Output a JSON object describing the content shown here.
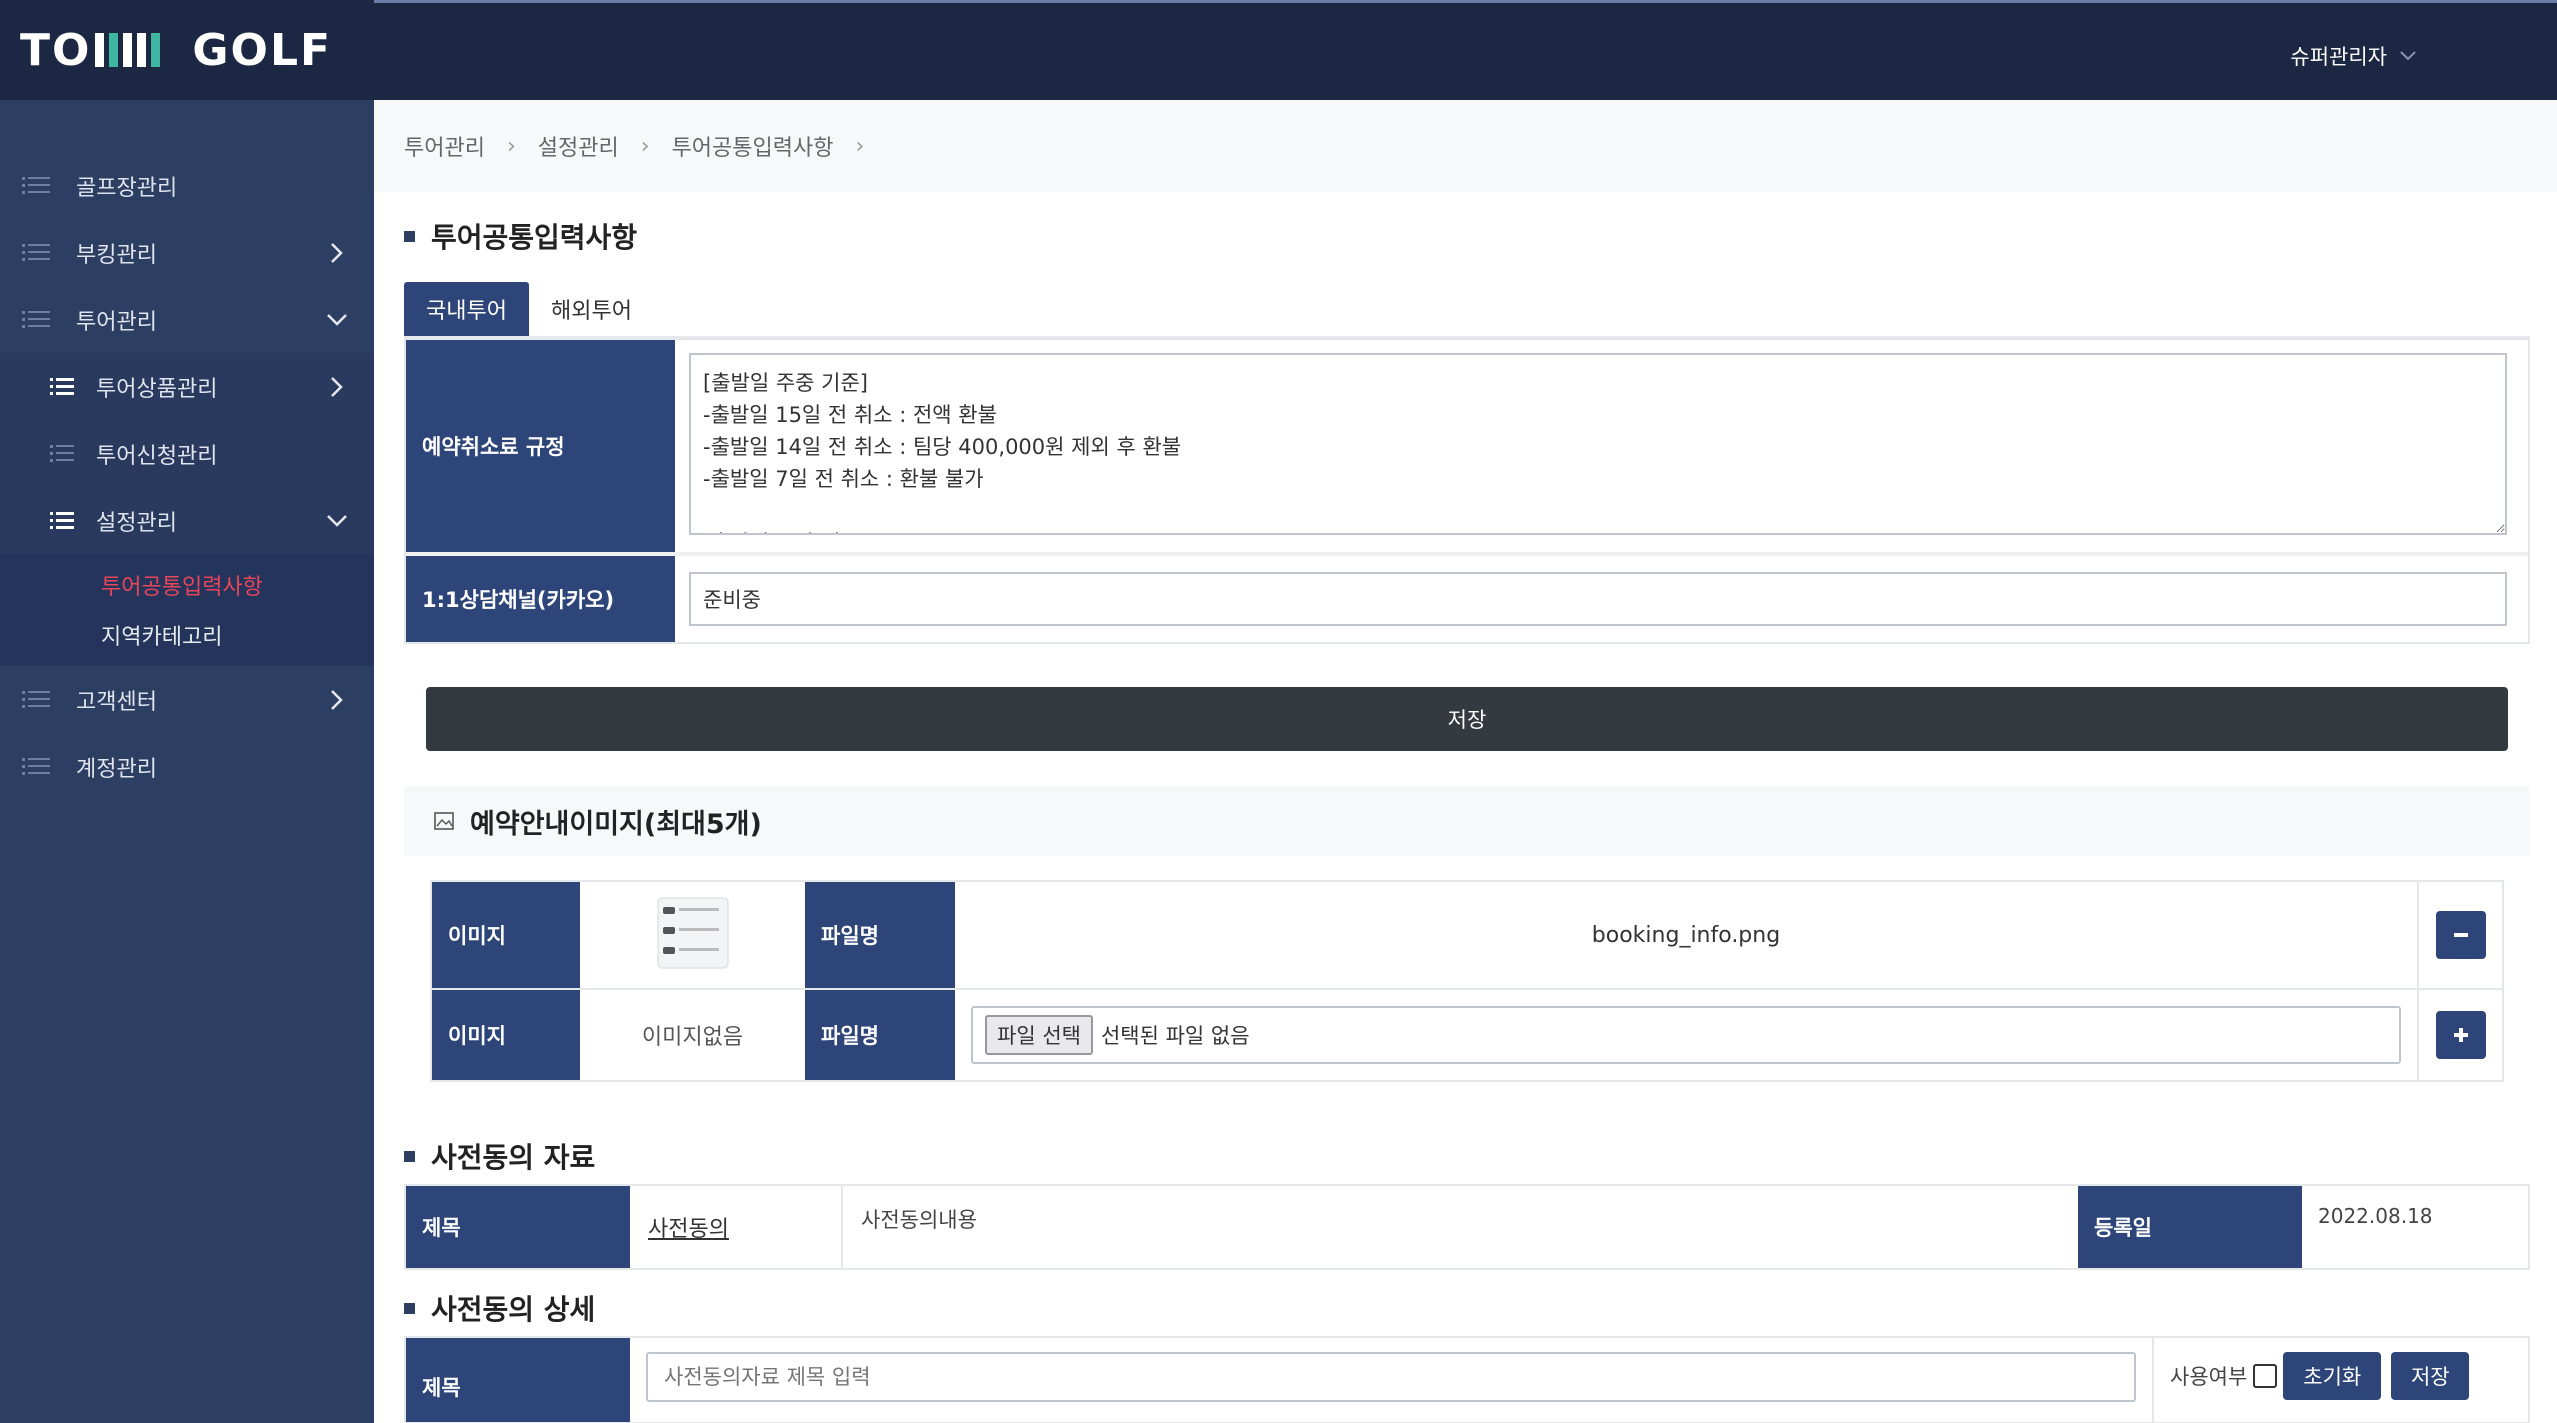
{
  "brand": {
    "logo_left": "TO",
    "logo_right": "GOLF"
  },
  "user": {
    "name": "슈퍼관리자"
  },
  "sidebar": {
    "items": [
      {
        "label": "골프장관리"
      },
      {
        "label": "부킹관리"
      },
      {
        "label": "투어관리"
      },
      {
        "label": "투어상품관리"
      },
      {
        "label": "투어신청관리"
      },
      {
        "label": "설정관리"
      },
      {
        "label": "투어공통입력사항"
      },
      {
        "label": "지역카테고리"
      },
      {
        "label": "고객센터"
      },
      {
        "label": "계정관리"
      }
    ]
  },
  "breadcrumb": [
    "투어관리",
    "설정관리",
    "투어공통입력사항"
  ],
  "page": {
    "title": "투어공통입력사항",
    "tabs": [
      "국내투어",
      "해외투어"
    ],
    "cancel_label": "예약취소료 규정",
    "cancel_text": "[출발일 주중 기준]\n-출발일 15일 전 취소 : 전액 환불\n-출발일 14일 전 취소 : 팀당 400,000원 제외 후 환불\n-출발일 7일 전 취소 : 환불 불가\n\n[출발일 주말 기준]",
    "kakao_label": "1:1상담채널(카카오)",
    "kakao_value": "준비중",
    "save_label": "저장"
  },
  "images": {
    "title": "예약안내이미지(최대5개)",
    "rows": [
      {
        "img_label": "이미지",
        "file_label": "파일명",
        "filename": "booking_info.png"
      },
      {
        "img_label": "이미지",
        "no_image": "이미지없음",
        "file_label": "파일명",
        "choose": "파일 선택",
        "no_file": "선택된 파일 없음"
      }
    ]
  },
  "consent": {
    "title": "사전동의 자료",
    "label_title": "제목",
    "link": "사전동의",
    "content": "사전동의내용",
    "date_label": "등록일",
    "date": "2022.08.18"
  },
  "consent_detail": {
    "title": "사전동의 상세",
    "label_title": "제목",
    "placeholder": "사전동의자료 제목 입력",
    "use_label": "사용여부",
    "reset": "초기화",
    "save": "저장"
  }
}
